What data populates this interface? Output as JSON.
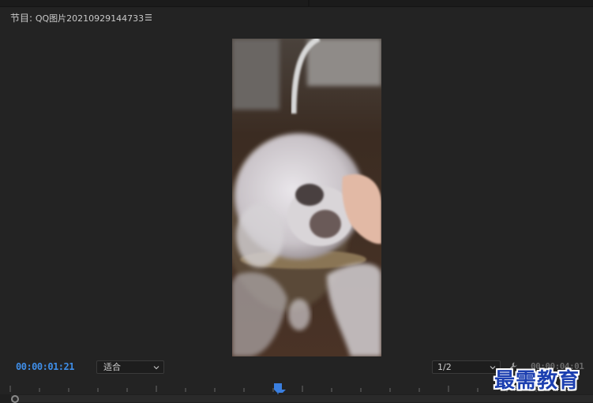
{
  "panel": {
    "title_prefix": "节目: ",
    "sequence_name": "QQ图片20210929144733"
  },
  "playback": {
    "current_timecode": "00:00:01:21",
    "duration_timecode": "00:00:04:01"
  },
  "controls": {
    "fit_label": "适合",
    "resolution_label": "1/2"
  },
  "watermark": {
    "text": "最需教育"
  },
  "colors": {
    "background": "#232323",
    "timecode": "#3f8ee8",
    "playhead": "#3a7fe0",
    "watermark": "#1c3fb0"
  },
  "icons": {
    "panel_menu": "hamburger-menu-icon",
    "dropdown": "chevron-down-icon",
    "settings": "wrench-icon",
    "playhead": "playhead-marker-icon"
  }
}
